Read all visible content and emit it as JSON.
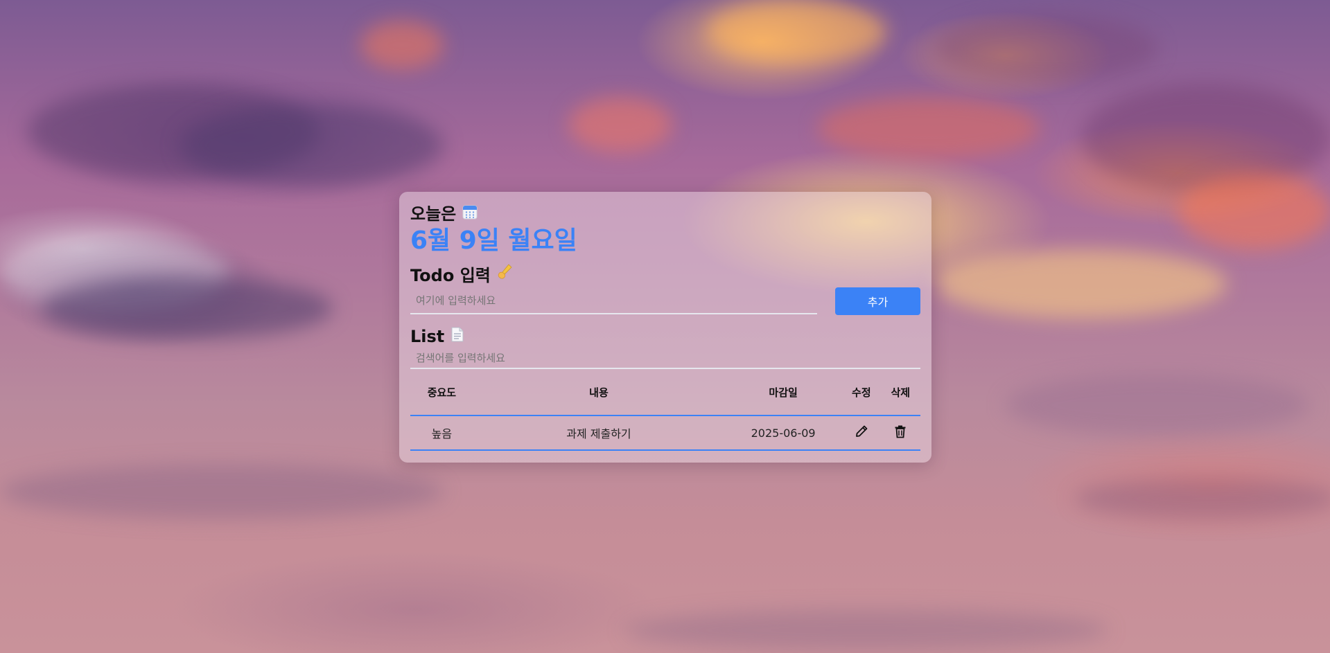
{
  "header": {
    "today_label": "오늘은",
    "calendar_icon": "calendar-icon",
    "date_text": "6월 9일 월요일",
    "accent_color": "#3b82f6"
  },
  "todo_input": {
    "title": "Todo 입력",
    "title_icon": "writing-hand-icon",
    "placeholder": "여기에 입력하세요",
    "add_label": "추가"
  },
  "list": {
    "title": "List",
    "title_icon": "document-icon",
    "search_placeholder": "검색어를 입력하세요",
    "columns": {
      "priority": "중요도",
      "content": "내용",
      "due": "마감일",
      "edit": "수정",
      "delete": "삭제"
    },
    "rows": [
      {
        "priority": "높음",
        "content": "과제 제출하기",
        "due": "2025-06-09",
        "edit_icon": "pencil-icon",
        "delete_icon": "trash-icon"
      }
    ]
  }
}
